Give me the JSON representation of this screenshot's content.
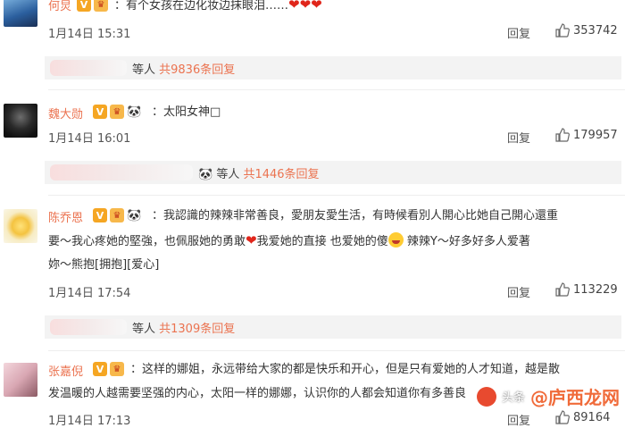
{
  "comments": [
    {
      "name": "何炅",
      "text": "：有个女孩在边化妆边抹眼泪……",
      "time": "1月14日 15:31",
      "reply": "回复",
      "likes": "353742"
    },
    {
      "name": "魏大勋",
      "text": "：太阳女神□",
      "time": "1月14日 16:01",
      "reply": "回复",
      "likes": "179957"
    },
    {
      "name": "陈乔恩",
      "line1": "：我認識的辣辣非常善良，愛朋友愛生活，有時候看別人開心比她自己開心還重",
      "line2a": "要～我心疼她的堅強，也佩服她的勇敢",
      "line2b": "我爱她的直接 也爱她的傻",
      "line2c": "辣辣Y～好多好多人爱著",
      "line3": "妳～熊抱[拥抱][爱心]",
      "time": "1月14日 17:54",
      "reply": "回复",
      "likes": "113229"
    },
    {
      "name": "张嘉倪",
      "line1": "：这样的娜姐，永远带给大家的都是快乐和开心，但是只有爱她的人才知道，越是散",
      "line2": "发温暖的人越需要坚强的内心，太阳一样的娜娜，认识你的人都会知道你有多善良",
      "time": "1月14日 17:13",
      "reply": "回复",
      "likes": "89164"
    }
  ],
  "more_replies": [
    {
      "prefix": "等人 ",
      "count": "共9836条回复"
    },
    {
      "prefix": "等人 ",
      "count": "共1446条回复"
    },
    {
      "prefix": "等人 ",
      "count": "共1309条回复"
    }
  ],
  "watermark": {
    "brand": "头条",
    "site": "@庐西龙网"
  },
  "colors": {
    "name": "#eb7350",
    "accent": "#eb7350",
    "heart": "#e0261b"
  }
}
